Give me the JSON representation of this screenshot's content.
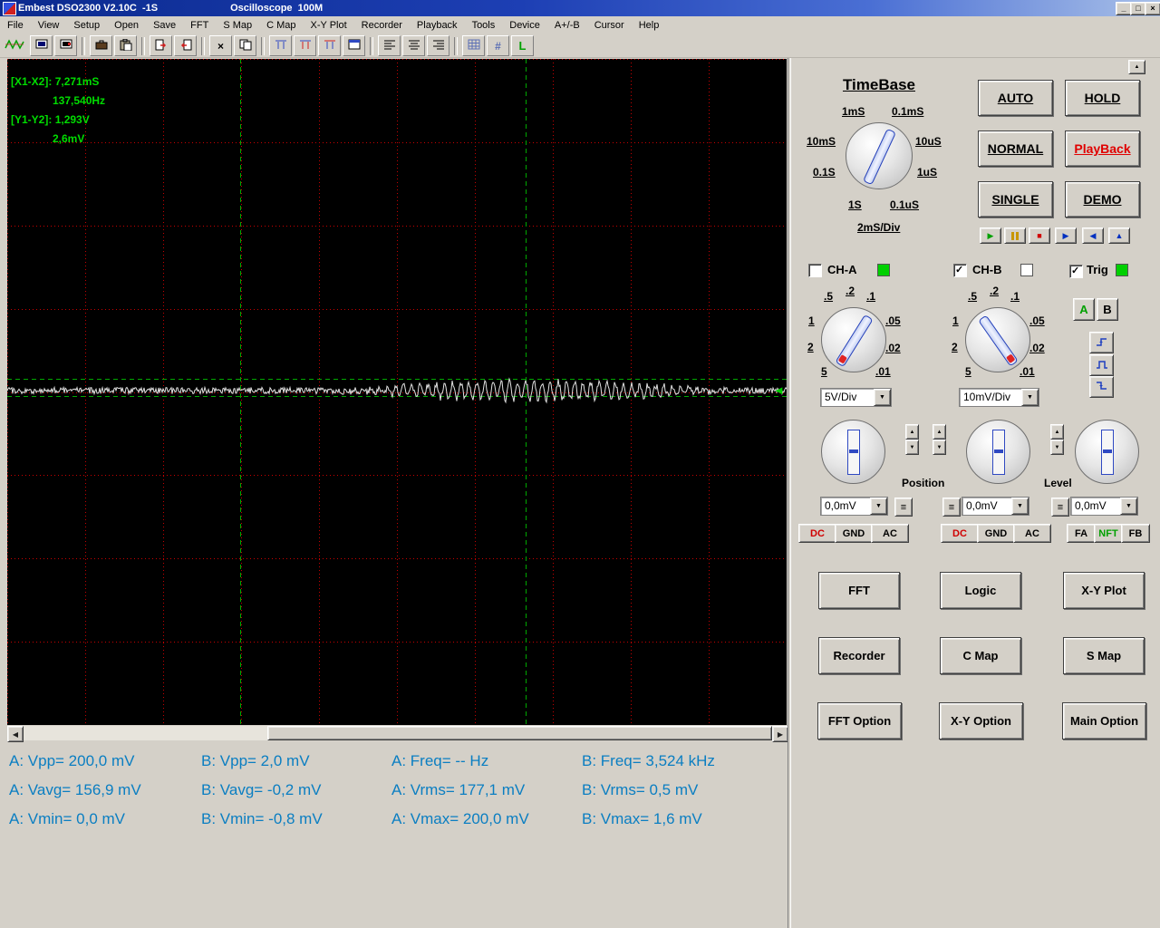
{
  "window": {
    "app_title": "Embest DSO2300 V2.10C  -1S",
    "doc_title": "Oscilloscope  100M"
  },
  "menu_items": [
    "File",
    "View",
    "Setup",
    "Open",
    "Save",
    "FFT",
    "S Map",
    "C Map",
    "X-Y Plot",
    "Recorder",
    "Playback",
    "Tools",
    "Device",
    "A+/-B",
    "Cursor",
    "Help"
  ],
  "icons": {
    "up": "▲",
    "down": "▼",
    "left": "◀",
    "right": "▶",
    "play": "▶",
    "stop": "■",
    "check": "✓",
    "close": "×",
    "minimize": "_",
    "maximize": "□",
    "menu_lines": "≡",
    "hash": "#",
    "label_l": "L",
    "delete_x": "×",
    "trig_marker": "◄"
  },
  "cursor_readout": {
    "x_label": "[X1-X2]:",
    "x_value": "7,271mS",
    "x_freq": "137,540Hz",
    "y_label": "[Y1-Y2]:",
    "y_value": "1,293V",
    "y_delta": "2,6mV"
  },
  "timebase": {
    "title": "TimeBase",
    "value": "2mS/Div",
    "labels": {
      "tl": "1mS",
      "tr": "0.1mS",
      "l": "10mS",
      "r": "10uS",
      "l2": "0.1S",
      "r2": "1uS",
      "bl": "1S",
      "br": "0.1uS"
    }
  },
  "mode_buttons": {
    "auto": "AUTO",
    "hold": "HOLD",
    "normal": "NORMAL",
    "playback": "PlayBack",
    "single": "SINGLE",
    "demo": "DEMO"
  },
  "channels": {
    "cha": {
      "label": "CH-A",
      "check": "",
      "volt": "5V/Div"
    },
    "chb": {
      "label": "CH-B",
      "check": "✓",
      "volt": "10mV/Div"
    },
    "trig": {
      "label": "Trig",
      "check": "✓"
    }
  },
  "volt_dial_labels": {
    "t1": ".5",
    "t2": ".2",
    "t3": ".1",
    "l1": "1",
    "r1": ".05",
    "l2": "2",
    "r2": ".02",
    "b1": "5",
    "b2": ".01"
  },
  "trigger_source": {
    "a": "A",
    "b": "B"
  },
  "position": {
    "label": "Position",
    "level_label": "Level",
    "a_value": "0,0mV",
    "b_value": "0,0mV",
    "level_value": "0,0mV"
  },
  "coupling": {
    "a": [
      "DC",
      "GND",
      "AC"
    ],
    "b": [
      "DC",
      "GND",
      "AC"
    ],
    "trig": [
      "FA",
      "NFT",
      "FB"
    ]
  },
  "panel_buttons": [
    "FFT",
    "Logic",
    "X-Y Plot",
    "Recorder",
    "C Map",
    "S Map",
    "FFT Option",
    "X-Y Option",
    "Main Option"
  ],
  "measurements": {
    "col1": [
      "A: Vpp= 200,0 mV",
      "A: Vavg= 156,9 mV",
      "A: Vmin= 0,0 mV"
    ],
    "col2": [
      "B: Vpp= 2,0 mV",
      "B: Vavg= -0,2 mV",
      "B: Vmin= -0,8 mV"
    ],
    "col3": [
      "A: Freq= -- Hz",
      "A: Vrms= 177,1 mV",
      "A: Vmax= 200,0 mV"
    ],
    "col4": [
      "B: Freq= 3,524 kHz",
      "B: Vrms= 0,5 mV",
      "B: Vmax= 1,6 mV"
    ]
  },
  "colors": {
    "accent_green": "#00d000",
    "cursor_green": "#00dd00",
    "grid_red": "#c80000",
    "measure_blue": "#0a7ec2",
    "playback_red": "#e00000"
  }
}
